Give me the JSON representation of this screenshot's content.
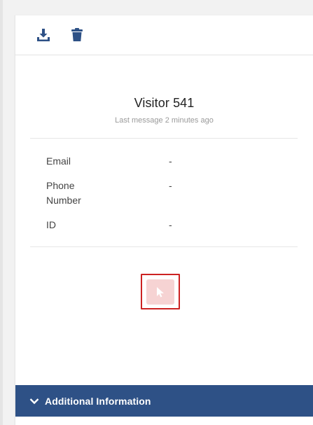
{
  "toolbar": {
    "download_icon": "download-icon",
    "delete_icon": "trash-icon"
  },
  "profile": {
    "name": "Visitor 541",
    "last_message": "Last message 2 minutes ago"
  },
  "fields": [
    {
      "label": "Email",
      "value": "-"
    },
    {
      "label": "Phone Number",
      "value": "-"
    },
    {
      "label": "ID",
      "value": "-"
    }
  ],
  "action": {
    "icon": "cursor-pointer-icon"
  },
  "accordion": {
    "label": "Additional Information",
    "icon": "chevron-down-icon"
  },
  "colors": {
    "accent": "#2e5186",
    "highlight_border": "#cc2222",
    "action_bg": "#f6d3d3"
  }
}
